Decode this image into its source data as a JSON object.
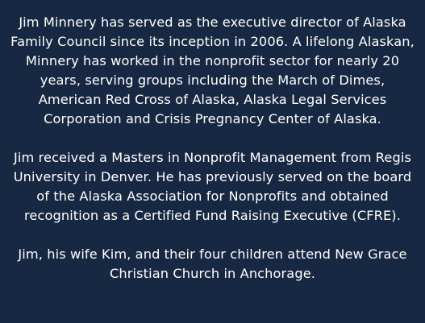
{
  "bio": {
    "paragraphs": [
      "Jim Minnery has served as the executive director of Alaska Family Council since its inception in 2006. A lifelong Alaskan, Minnery has worked in the nonprofit sector for nearly 20 years, serving groups including the March of Dimes, American Red Cross of Alaska, Alaska Legal Services Corporation and Crisis Pregnancy Center of Alaska.",
      "Jim received a Masters in Nonprofit Management from Regis University in Denver. He has previously served on the board of the Alaska Association for Nonprofits and obtained recognition as a Certified Fund Raising Executive (CFRE).",
      "Jim, his wife Kim, and their four children attend New Grace Christian Church in Anchorage."
    ]
  },
  "colors": {
    "background": "#172842",
    "text": "#ffffff"
  }
}
